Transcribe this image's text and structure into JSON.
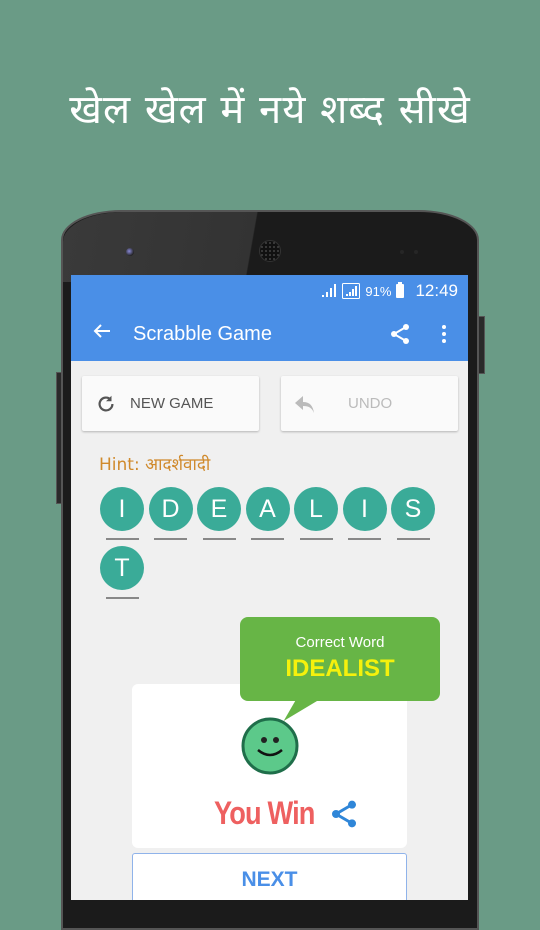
{
  "promo": {
    "headline": "खेल खेल में नये शब्द सीखे"
  },
  "statusbar": {
    "battery": "91%",
    "time": "12:49"
  },
  "appbar": {
    "title": "Scrabble Game",
    "back_icon": "arrow-left-icon",
    "share_icon": "share-icon",
    "more_icon": "more-vert-icon"
  },
  "buttons": {
    "new_game": "NEW GAME",
    "undo": "UNDO"
  },
  "hint": {
    "label": "Hint: आदर्शवादी"
  },
  "tiles": [
    "I",
    "D",
    "E",
    "A",
    "L",
    "I",
    "S",
    "T"
  ],
  "result": {
    "bubble_title": "Correct Word",
    "correct_word": "IDEALIST",
    "message": "You Win",
    "next_label": "NEXT"
  },
  "colors": {
    "background": "#6a9b86",
    "appbar": "#4a8fe7",
    "tile": "#3aab98",
    "hint": "#d08a2c",
    "bubble": "#67b546",
    "win_text": "#ee6060"
  }
}
